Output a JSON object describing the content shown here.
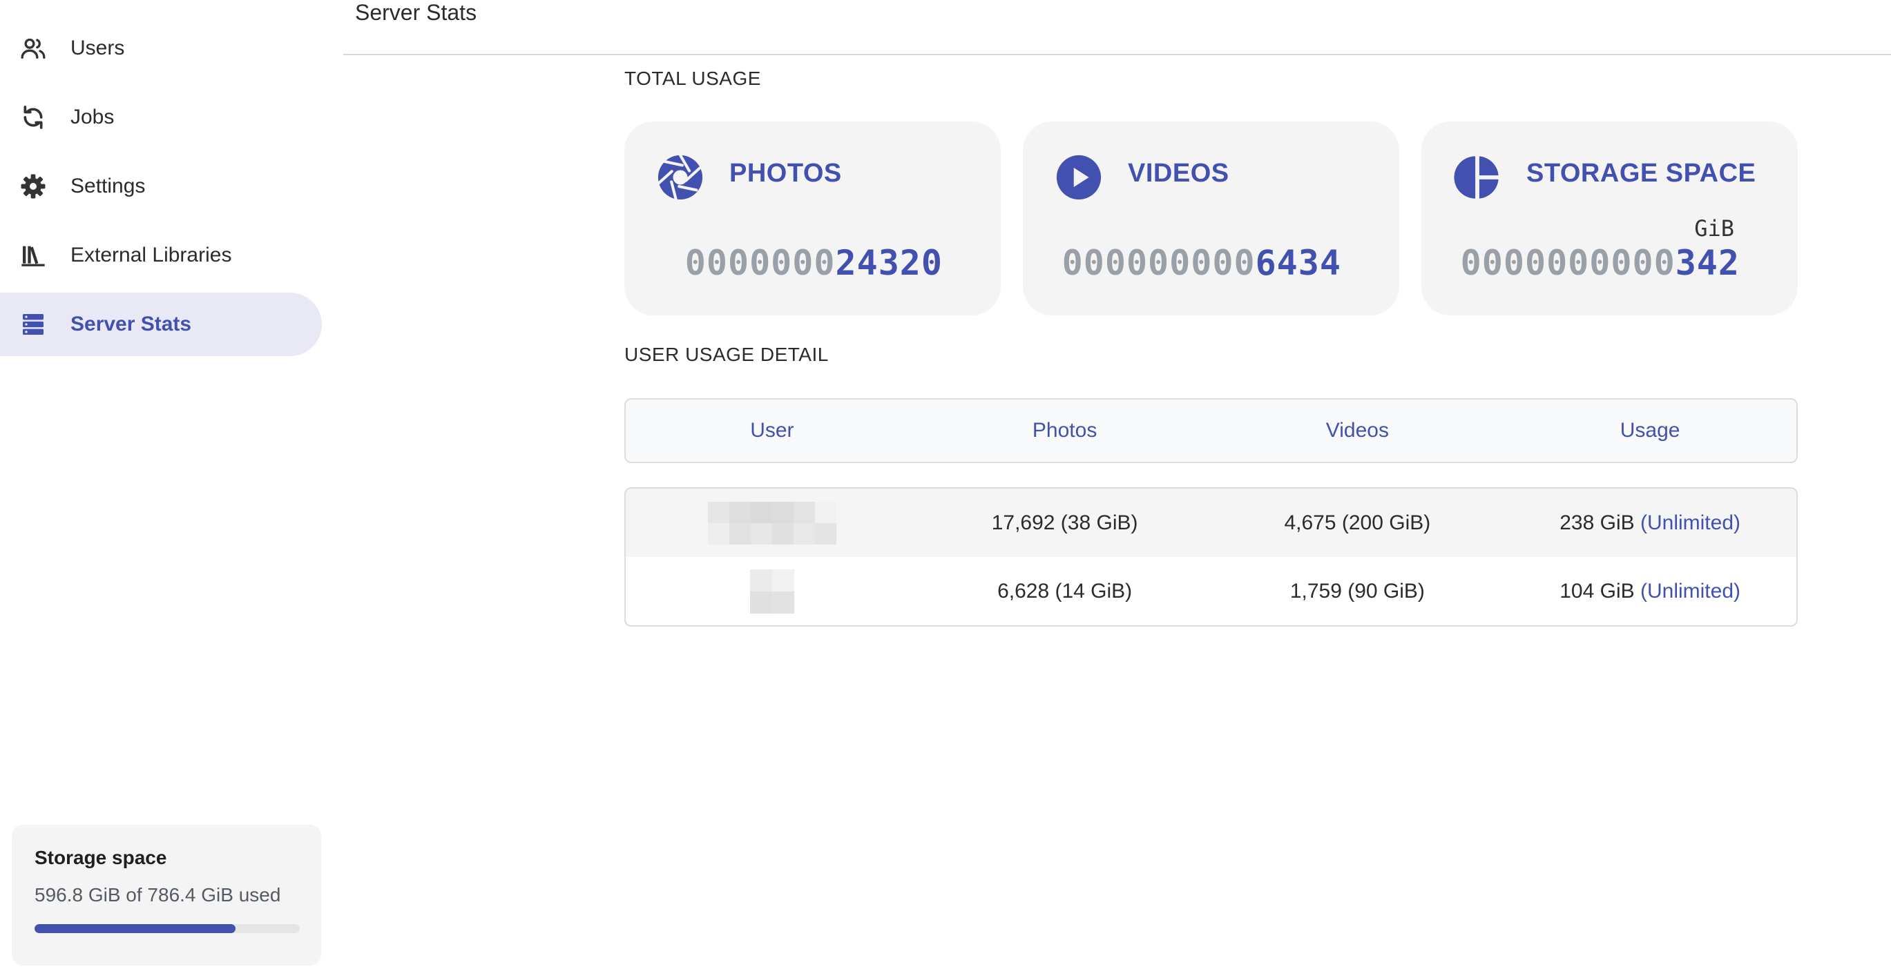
{
  "sidebar": {
    "items": [
      {
        "label": "Users",
        "icon": "users-icon"
      },
      {
        "label": "Jobs",
        "icon": "sync-icon"
      },
      {
        "label": "Settings",
        "icon": "gear-icon"
      },
      {
        "label": "External Libraries",
        "icon": "library-icon"
      },
      {
        "label": "Server Stats",
        "icon": "server-icon",
        "active": true
      }
    ],
    "storage": {
      "title": "Storage space",
      "text": "596.8 GiB of 786.4 GiB used",
      "used_fraction": 0.759
    }
  },
  "header": {
    "title": "Server Stats"
  },
  "total_usage": {
    "label": "TOTAL USAGE",
    "cards": [
      {
        "title": "PHOTOS",
        "unit": "",
        "pad": "0000000",
        "value": "24320",
        "icon": "aperture-icon"
      },
      {
        "title": "VIDEOS",
        "unit": "",
        "pad": "000000000",
        "value": "6434",
        "icon": "play-circle-icon"
      },
      {
        "title": "STORAGE SPACE",
        "unit": "GiB",
        "pad": "0000000000",
        "value": "342",
        "icon": "pie-chart-icon"
      }
    ]
  },
  "user_usage": {
    "label": "USER USAGE DETAIL",
    "columns": [
      "User",
      "Photos",
      "Videos",
      "Usage"
    ],
    "rows": [
      {
        "photos": "17,692 (38 GiB)",
        "videos": "4,675 (200 GiB)",
        "usage": "238 GiB",
        "quota": "(Unlimited)"
      },
      {
        "photos": "6,628 (14 GiB)",
        "videos": "1,759 (90 GiB)",
        "usage": "104 GiB",
        "quota": "(Unlimited)"
      }
    ]
  },
  "colors": {
    "accent": "#4250af",
    "active_bg": "#e9e9f6",
    "card_bg": "#f4f4f4",
    "pad_digits": "#9aa0a8"
  }
}
